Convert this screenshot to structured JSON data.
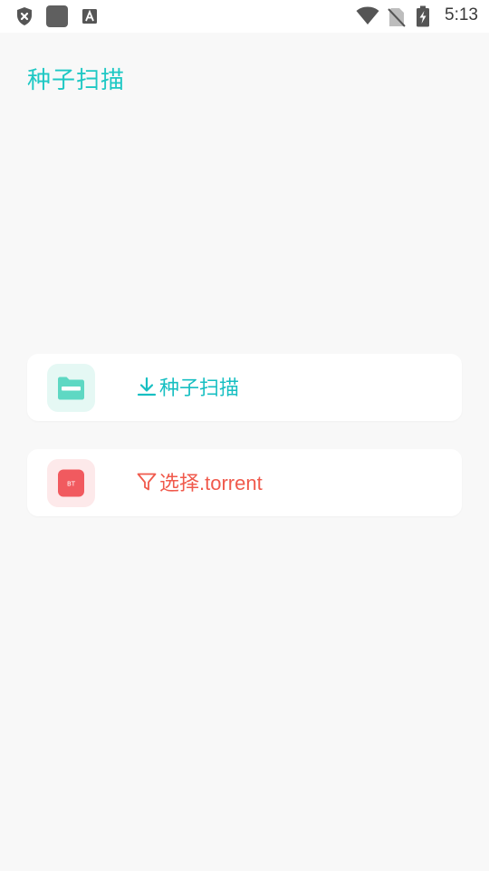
{
  "status_bar": {
    "time": "5:13",
    "icons": [
      "shield-close-icon",
      "app-square-icon",
      "a-font-icon",
      "wifi-icon",
      "no-sim-icon",
      "battery-charging-icon"
    ]
  },
  "header": {
    "title": "种子扫描"
  },
  "cards": [
    {
      "label": "种子扫描",
      "icon": "folder-icon",
      "label_icon": "download-icon",
      "color": "#17bfc2",
      "icon_bg": "#e5f8f4"
    },
    {
      "label": "选择.torrent",
      "icon": "bt-file-icon",
      "icon_text": "BT",
      "label_icon": "filter-icon",
      "color": "#f05a4c",
      "icon_bg": "#fde9ea"
    }
  ],
  "colors": {
    "background": "#f8f8f8",
    "accent": "#1ec8c4",
    "folder": "#5ed8c3",
    "bt": "#f15a5f"
  }
}
